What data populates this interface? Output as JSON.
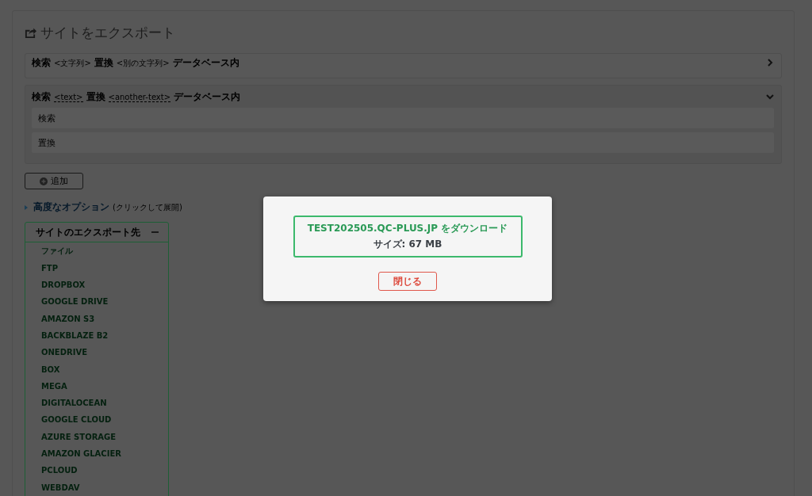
{
  "page": {
    "title": "サイトをエクスポート"
  },
  "rules": [
    {
      "expanded": false,
      "parts": [
        {
          "kind": "keyword",
          "text": "検索"
        },
        {
          "kind": "tag",
          "text": "<文字列>"
        },
        {
          "kind": "keyword",
          "text": "置換"
        },
        {
          "kind": "tag",
          "text": "<別の文字列>"
        },
        {
          "kind": "keyword",
          "text": "データベース内"
        }
      ]
    },
    {
      "expanded": true,
      "parts": [
        {
          "kind": "keyword",
          "text": "検索"
        },
        {
          "kind": "dotted-tag",
          "text": "<text>"
        },
        {
          "kind": "keyword",
          "text": "置換"
        },
        {
          "kind": "dotted-tag",
          "text": "<another-text>"
        },
        {
          "kind": "keyword",
          "text": "データベース内"
        }
      ],
      "fields": [
        {
          "placeholder": "検索"
        },
        {
          "placeholder": "置換"
        }
      ]
    }
  ],
  "add_button": {
    "label": "追加"
  },
  "advanced": {
    "link": "高度なオプション",
    "hint": "(クリックして展開)"
  },
  "export_menu": {
    "title": "サイトのエクスポート先",
    "expanded": true,
    "items": [
      "ファイル",
      "FTP",
      "DROPBOX",
      "GOOGLE DRIVE",
      "AMAZON S3",
      "BACKBLAZE B2",
      "ONEDRIVE",
      "BOX",
      "MEGA",
      "DIGITALOCEAN",
      "GOOGLE CLOUD",
      "AZURE STORAGE",
      "AMAZON GLACIER",
      "PCLOUD",
      "WEBDAV"
    ]
  },
  "dialog": {
    "download_link": "TEST202505.QC-PLUS.JP をダウンロード",
    "size": "サイズ: 67 MB",
    "close_button": "閉じる"
  }
}
